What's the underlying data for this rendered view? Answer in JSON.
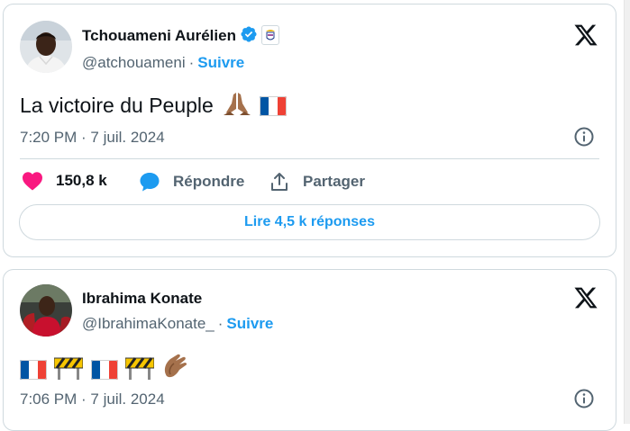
{
  "tweets": [
    {
      "author": {
        "name": "Tchouameni Aurélien",
        "handle": "@atchouameni",
        "follow_label": "Suivre",
        "verified": true,
        "affiliation_badge": "real-madrid-crest"
      },
      "text": "La victoire du Peuple",
      "text_emojis": [
        "folded-hands-medium-dark",
        "flag-france"
      ],
      "timestamp": "7:20 PM · 7 juil. 2024",
      "actions": {
        "likes": "150,8 k",
        "reply_label": "Répondre",
        "share_label": "Partager"
      },
      "read_replies_label": "Lire 4,5 k réponses"
    },
    {
      "author": {
        "name": "Ibrahima Konate",
        "handle": "@IbrahimaKonate_",
        "follow_label": "Suivre"
      },
      "text_emojis": [
        "flag-france",
        "construction-barrier",
        "flag-france",
        "construction-barrier",
        "clapping-hands-medium-dark"
      ],
      "timestamp": "7:06 PM · 7 juil. 2024"
    }
  ],
  "colors": {
    "accent": "#1d9bf0",
    "like": "#f91880",
    "muted": "#536471",
    "text": "#0f1419",
    "border": "#cfd9de"
  },
  "icons": [
    "x-logo-icon",
    "verified-badge-icon",
    "info-icon",
    "heart-icon",
    "reply-bubble-icon",
    "share-icon"
  ]
}
